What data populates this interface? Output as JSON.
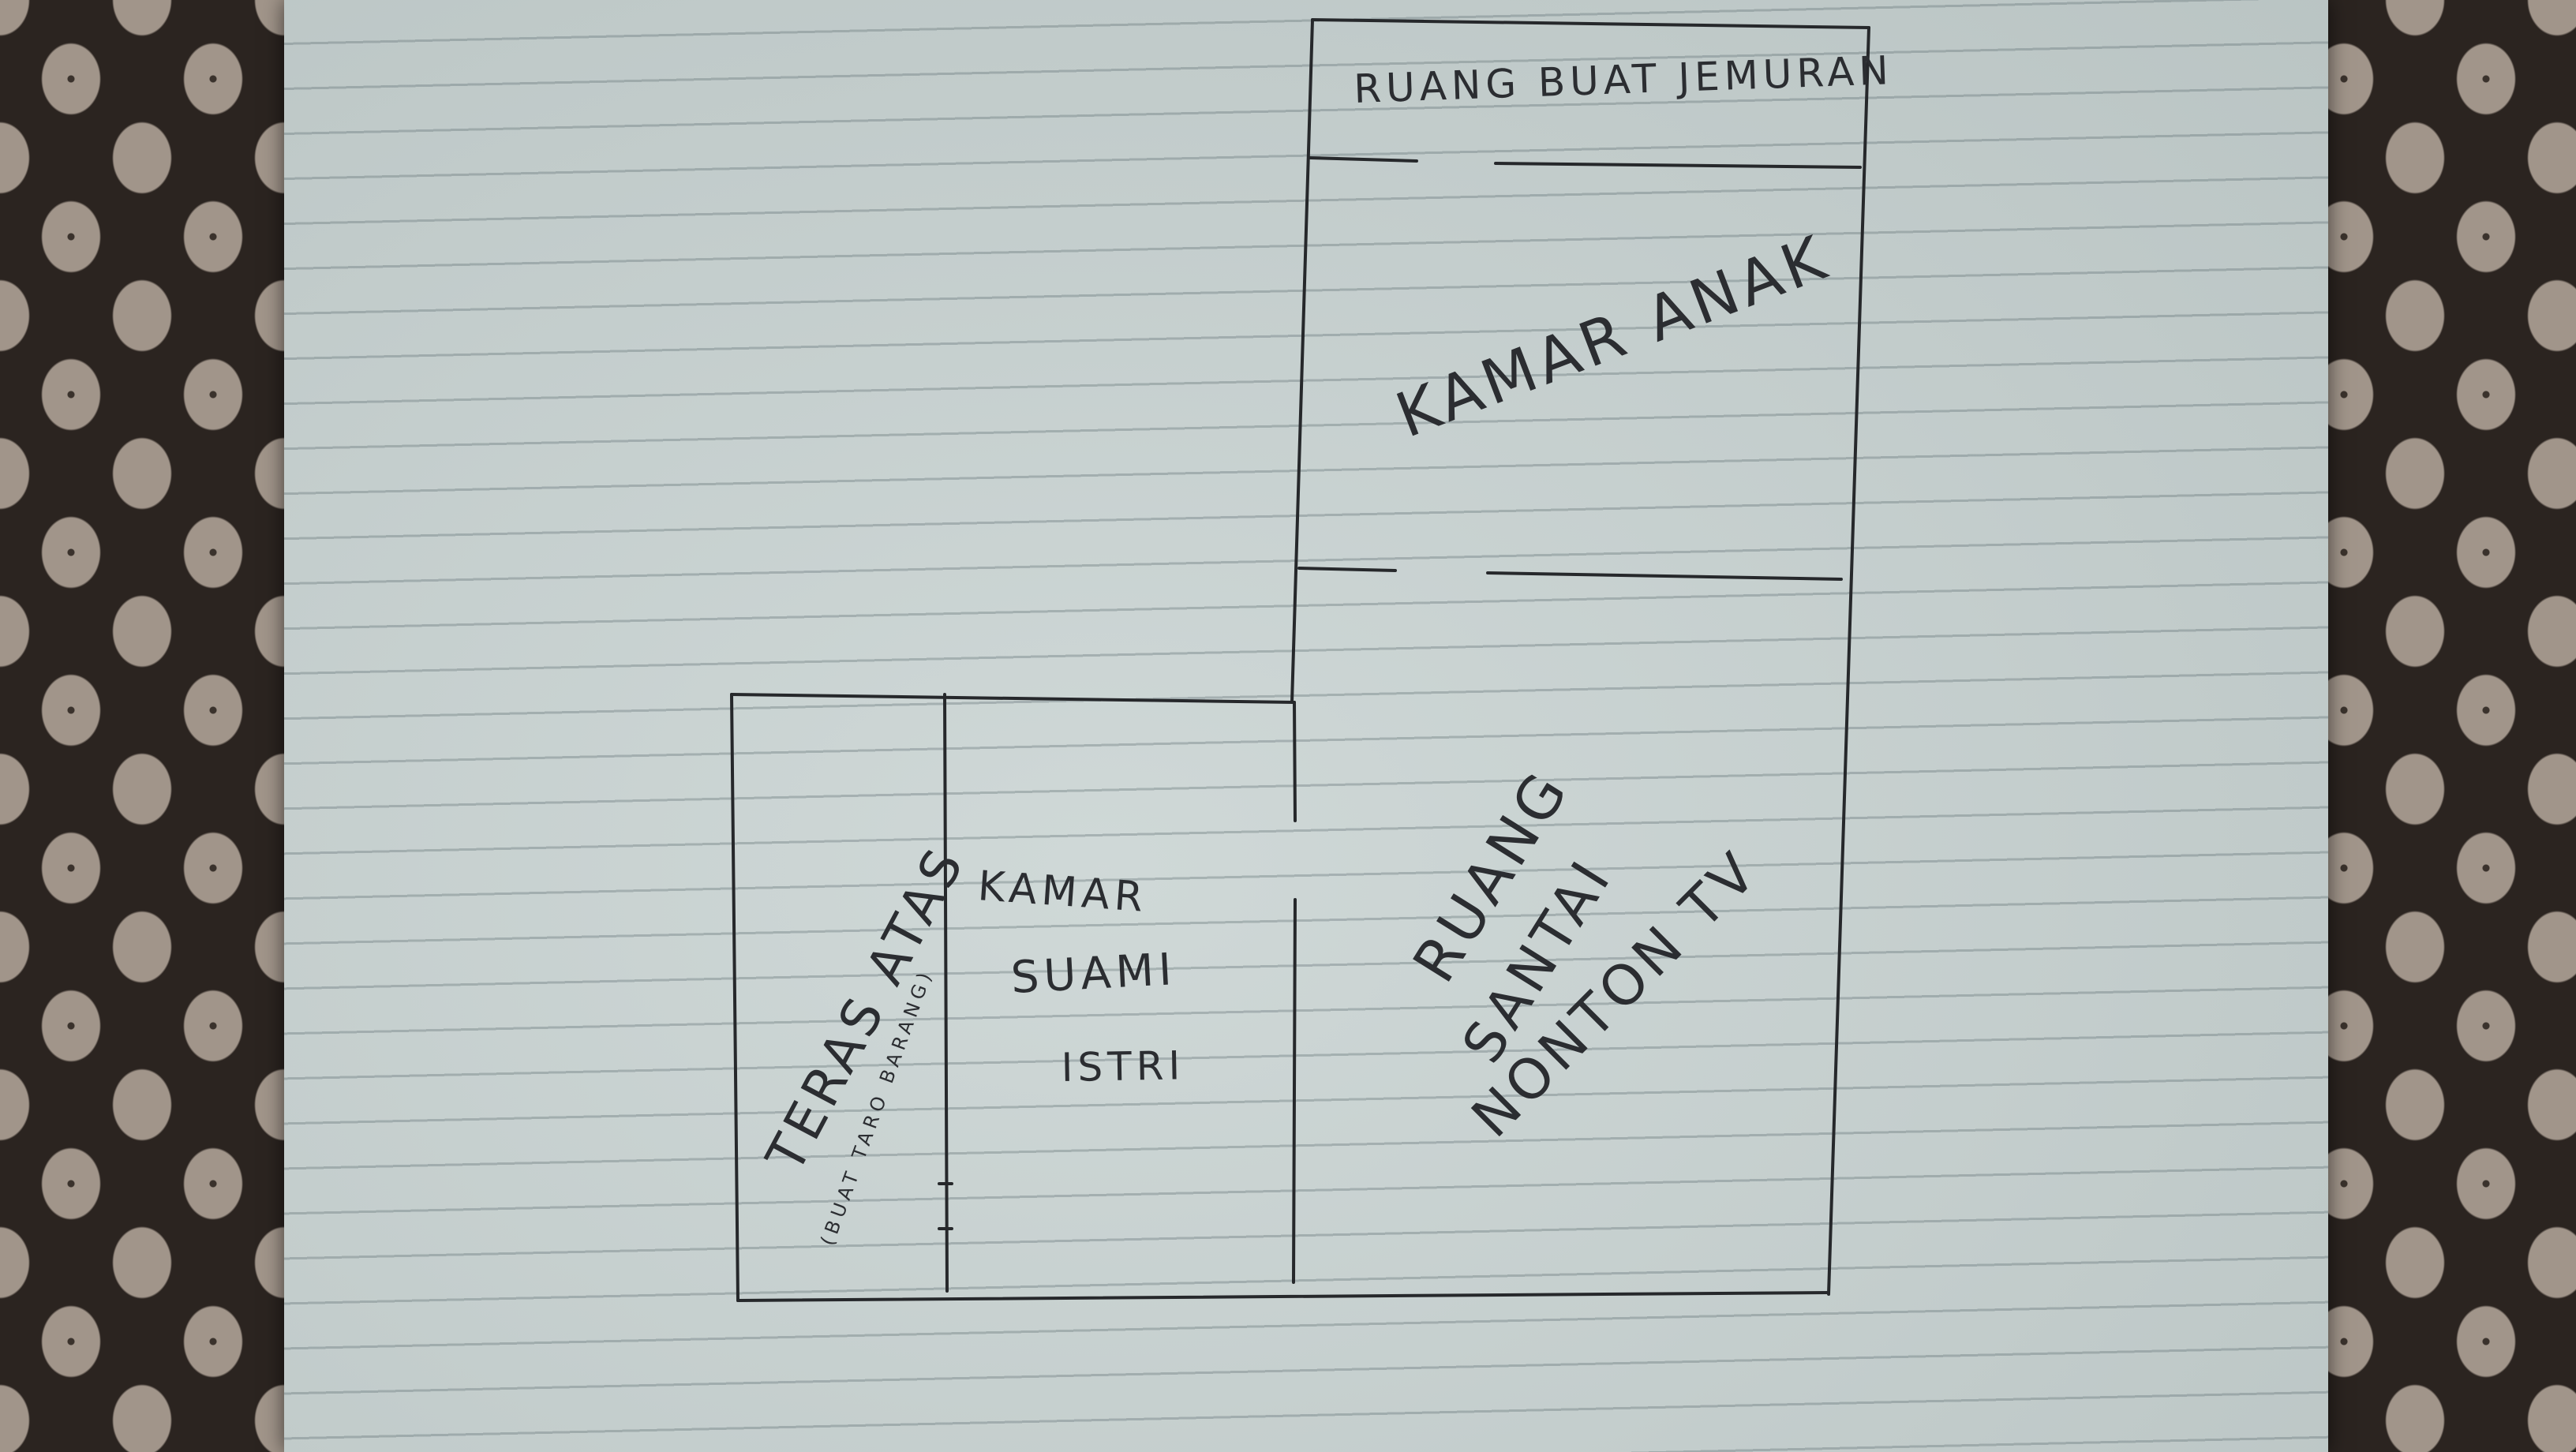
{
  "labels": {
    "clothesline_room": "RUANG BUAT JEMURAN",
    "kids_room": "KAMAR ANAK",
    "terrace_line1": "TERAS ATAS",
    "terrace_line2": "(BUAT TARO BARANG)",
    "master_room_line1": "KAMAR",
    "master_room_line2": "SUAMI",
    "master_room_line3": "ISTRI",
    "lounge_line1": "RUANG",
    "lounge_line2": "SANTAI",
    "lounge_line3": "NONTON TV"
  },
  "colors": {
    "paper": "#c6d0cf",
    "ink": "#26282b",
    "batik_dark": "#2b2420",
    "batik_light": "#a1958a"
  }
}
